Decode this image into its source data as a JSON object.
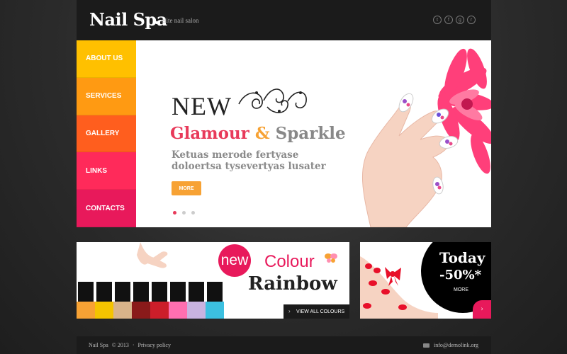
{
  "header": {
    "logo": "Nail Spa",
    "tagline": "elite nail salon",
    "social_icons": [
      "twitter-icon",
      "facebook-icon",
      "google-plus-icon",
      "rss-icon"
    ],
    "social_glyphs": [
      "t",
      "f",
      "g",
      "r"
    ]
  },
  "nav": {
    "items": [
      {
        "label": "ABOUT US",
        "color": "#ffc000"
      },
      {
        "label": "SERVICES",
        "color": "#ff9a12"
      },
      {
        "label": "GALLERY",
        "color": "#ff5e1e"
      },
      {
        "label": "LINKS",
        "color": "#ff2a5a"
      },
      {
        "label": "CONTACTS",
        "color": "#e8195b"
      }
    ]
  },
  "hero": {
    "new_label": "NEW",
    "title_part1": "Glamour",
    "title_amp": "&",
    "title_part2": "Sparkle",
    "subtitle": "Ketuas merode fertyase doloertsa tysevertyas lusater",
    "button": "MORE",
    "active_slide": 0,
    "slide_count": 3
  },
  "banner_colour": {
    "badge": "new",
    "colour": "Colour",
    "rainbow": "Rainbow",
    "button": "VIEW ALL COLOURS"
  },
  "banner_sale": {
    "today": "Today",
    "discount": "-50%*",
    "more": "MORE"
  },
  "footer": {
    "brand": "Nail Spa",
    "copyright": "© 2013",
    "separator": "·",
    "privacy": "Privacy policy",
    "email": "info@demolink.org"
  },
  "colors": {
    "accent_pink": "#e83a5a",
    "accent_orange": "#f7a234",
    "magenta": "#e8195b"
  }
}
